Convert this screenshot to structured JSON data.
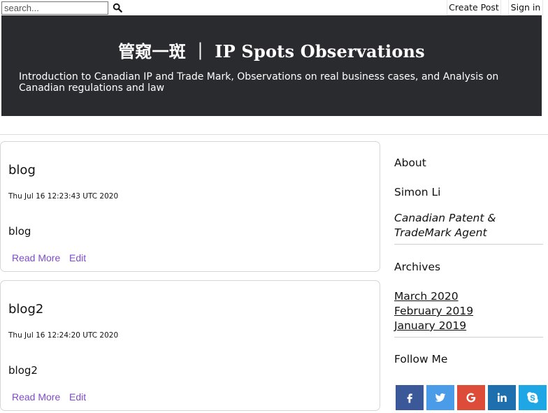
{
  "topbar": {
    "search_placeholder": "search...",
    "create_post": "Create Post",
    "sign_in": "Sign in"
  },
  "banner": {
    "title": "管窥一斑 ｜ IP Spots Observations",
    "description": "Introduction to Canadian IP and Trade Mark, Observations on real business cases, and Analysis on Canadian regulations and law"
  },
  "posts": [
    {
      "title": "blog",
      "date": "Thu Jul 16 12:23:43 UTC 2020",
      "excerpt": "blog",
      "read_more": "Read More",
      "edit": "Edit"
    },
    {
      "title": "blog2",
      "date": "Thu Jul 16 12:24:20 UTC 2020",
      "excerpt": "blog2",
      "read_more": "Read More",
      "edit": "Edit"
    }
  ],
  "sidebar": {
    "about_heading": "About",
    "author_name": "Simon Li",
    "author_role": "Canadian Patent & TradeMark Agent",
    "archives_heading": "Archives",
    "archives": [
      "March 2020",
      "February 2019",
      "January 2019"
    ],
    "follow_heading": "Follow Me",
    "social": [
      {
        "icon": "facebook-icon",
        "color": "#3b5998"
      },
      {
        "icon": "twitter-icon",
        "color": "#4a9be8"
      },
      {
        "icon": "google-plus-icon",
        "color": "#dd4b39"
      },
      {
        "icon": "linkedin-icon",
        "color": "#1d6fae"
      },
      {
        "icon": "skype-icon",
        "color": "#1ea7e4"
      }
    ]
  },
  "colors": {
    "banner_bg": "#292b2f",
    "link": "#7d4cc9"
  }
}
